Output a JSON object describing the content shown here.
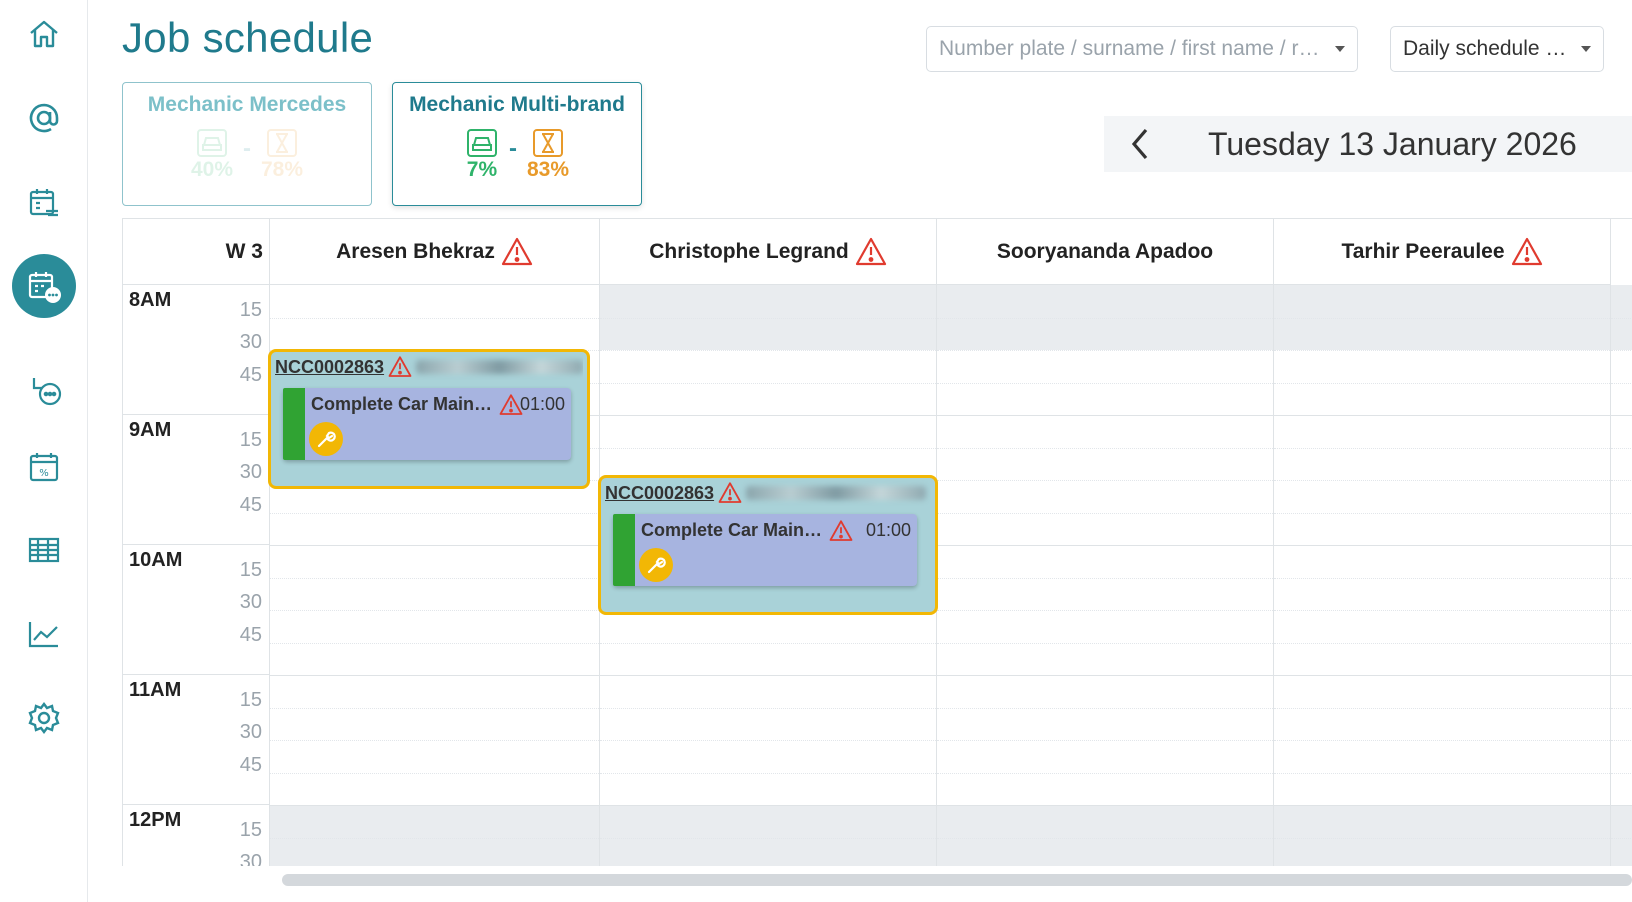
{
  "page": {
    "title": "Job schedule"
  },
  "sidebar": {
    "items": [
      {
        "icon": "home-icon"
      },
      {
        "icon": "at-icon"
      },
      {
        "icon": "calendar-list-icon"
      },
      {
        "icon": "calendar-chat-icon",
        "active": true
      },
      {
        "icon": "flow-chat-icon"
      },
      {
        "icon": "calendar-percent-icon"
      },
      {
        "icon": "table-icon"
      },
      {
        "icon": "chart-line-icon"
      },
      {
        "icon": "gear-icon"
      }
    ]
  },
  "search": {
    "placeholder": "Number plate / surname / first name / r…"
  },
  "view_select": {
    "value": "Daily schedule …"
  },
  "workshops": [
    {
      "name": "Mechanic Mercedes",
      "occupancy": "40%",
      "load": "78%",
      "active": false
    },
    {
      "name": "Mechanic Multi-brand",
      "occupancy": "7%",
      "load": "83%",
      "active": true
    }
  ],
  "colors": {
    "accent": "#1f7a8c",
    "occupancy": "#2fb36a",
    "load": "#e89a2a",
    "warning": "#e03b2f",
    "highlight": "#f2b705"
  },
  "date_nav": {
    "label": "Tuesday 13 January 2026"
  },
  "calendar": {
    "week": "W 3",
    "columns": [
      {
        "name": "Aresen Bhekraz",
        "warning": true
      },
      {
        "name": "Christophe Legrand",
        "warning": true
      },
      {
        "name": "Sooryananda Apadoo",
        "warning": false
      },
      {
        "name": "Tarhir Peeraulee",
        "warning": true
      }
    ],
    "hours": [
      {
        "label": "8AM",
        "quarters": [
          "15",
          "30",
          "45"
        ]
      },
      {
        "label": "9AM",
        "quarters": [
          "15",
          "30",
          "45"
        ]
      },
      {
        "label": "10AM",
        "quarters": [
          "15",
          "30",
          "45"
        ]
      },
      {
        "label": "11AM",
        "quarters": [
          "15",
          "30",
          "45"
        ]
      },
      {
        "label": "12PM",
        "quarters": [
          "15",
          "30"
        ]
      }
    ],
    "appointments": [
      {
        "ref": "NCC0002863",
        "task": "Complete Car Main…",
        "duration": "01:00",
        "column": "Aresen Bhekraz",
        "start": "8:30"
      },
      {
        "ref": "NCC0002863",
        "task": "Complete Car Main…",
        "duration": "01:00",
        "column": "Christophe Legrand",
        "start": "9:30"
      }
    ]
  }
}
